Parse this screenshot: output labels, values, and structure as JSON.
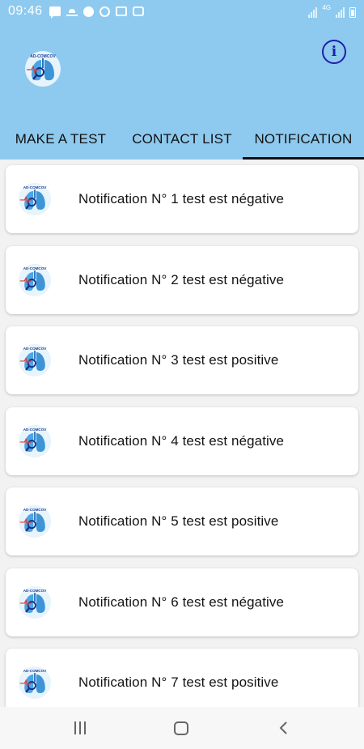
{
  "status_bar": {
    "time": "09:46",
    "network": "4G",
    "left_icons": [
      "message-icon",
      "weather-icon",
      "messenger-icon",
      "alarm-icon",
      "gallery-icon",
      "app-icon"
    ],
    "right_icons": [
      "signal-icon",
      "signal-icon",
      "battery-icon"
    ]
  },
  "app_bar": {
    "logo_icon": "lungs-logo-icon",
    "info_icon": "info-icon",
    "info_glyph": "i",
    "colors": {
      "background": "#8ecaef",
      "info": "#1f1fa8"
    }
  },
  "tabs": [
    {
      "label": "MAKE A TEST",
      "active": false
    },
    {
      "label": "CONTACT LIST",
      "active": false
    },
    {
      "label": "NOTIFICATION",
      "active": true
    }
  ],
  "notifications": [
    {
      "text": "Notification N° 1 test est négative",
      "icon": "lungs-logo-icon"
    },
    {
      "text": "Notification N° 2 test est négative",
      "icon": "lungs-logo-icon"
    },
    {
      "text": "Notification N° 3 test est positive",
      "icon": "lungs-logo-icon"
    },
    {
      "text": "Notification N° 4 test est négative",
      "icon": "lungs-logo-icon"
    },
    {
      "text": "Notification N° 5 test est positive",
      "icon": "lungs-logo-icon"
    },
    {
      "text": "Notification N° 6 test est négative",
      "icon": "lungs-logo-icon"
    },
    {
      "text": "Notification N° 7 test est positive",
      "icon": "lungs-logo-icon"
    }
  ],
  "nav_bar": {
    "recent_icon": "recent-apps-icon",
    "home_icon": "home-icon",
    "back_icon": "back-icon"
  }
}
